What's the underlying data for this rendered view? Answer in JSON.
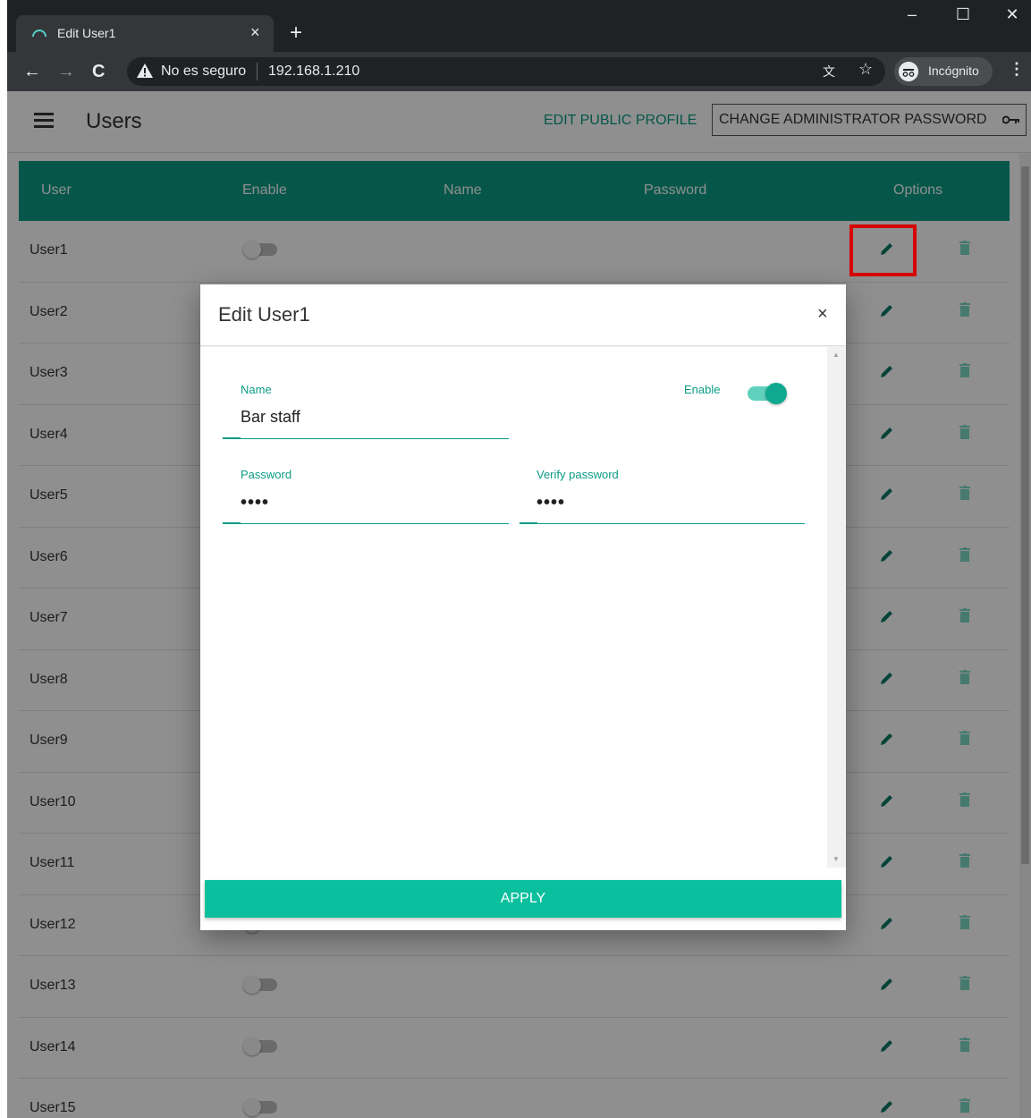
{
  "browser": {
    "tab_title": "Edit User1",
    "new_tab": "+",
    "tab_close": "×",
    "security": "No es seguro",
    "url": "192.168.1.210",
    "incognito": "Incógnito",
    "window_controls": {
      "minimize": "–",
      "maximize": "☐",
      "close": "✕"
    }
  },
  "app": {
    "title": "Users",
    "edit_public_profile": "EDIT PUBLIC PROFILE",
    "change_admin_password": "CHANGE ADMINISTRATOR PASSWORD"
  },
  "table": {
    "headers": {
      "user": "User",
      "enable": "Enable",
      "name": "Name",
      "password": "Password",
      "options": "Options"
    },
    "rows": [
      "User1",
      "User2",
      "User3",
      "User4",
      "User5",
      "User6",
      "User7",
      "User8",
      "User9",
      "User10",
      "User11",
      "User12",
      "User13",
      "User14",
      "User15"
    ]
  },
  "modal": {
    "title": "Edit User1",
    "close": "×",
    "name_label": "Name",
    "name_value": "Bar staff",
    "enable_label": "Enable",
    "enable_value": true,
    "password_label": "Password",
    "password_value": "••••",
    "verify_label": "Verify password",
    "verify_value": "••••",
    "apply": "APPLY"
  },
  "colors": {
    "accent": "#0b9c85",
    "apply": "#0abf9e",
    "highlight": "#d60000"
  },
  "icons": [
    "menu-icon",
    "key-icon",
    "pencil-icon",
    "trash-icon",
    "close-icon",
    "warning-icon",
    "star-icon",
    "translate-icon",
    "incognito-icon"
  ]
}
